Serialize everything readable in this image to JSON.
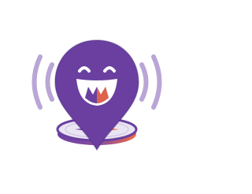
{
  "logo": {
    "icon": "smiling-location-pin-with-compass-and-sound-waves",
    "colors": {
      "purple": "#6a3fa0",
      "purple_dark": "#4a2878",
      "orange": "#f26a3d",
      "wave_lavender": "#b9a6d6",
      "compass_base": "#e9e4f2",
      "mouth_white": "#ffffff"
    }
  }
}
